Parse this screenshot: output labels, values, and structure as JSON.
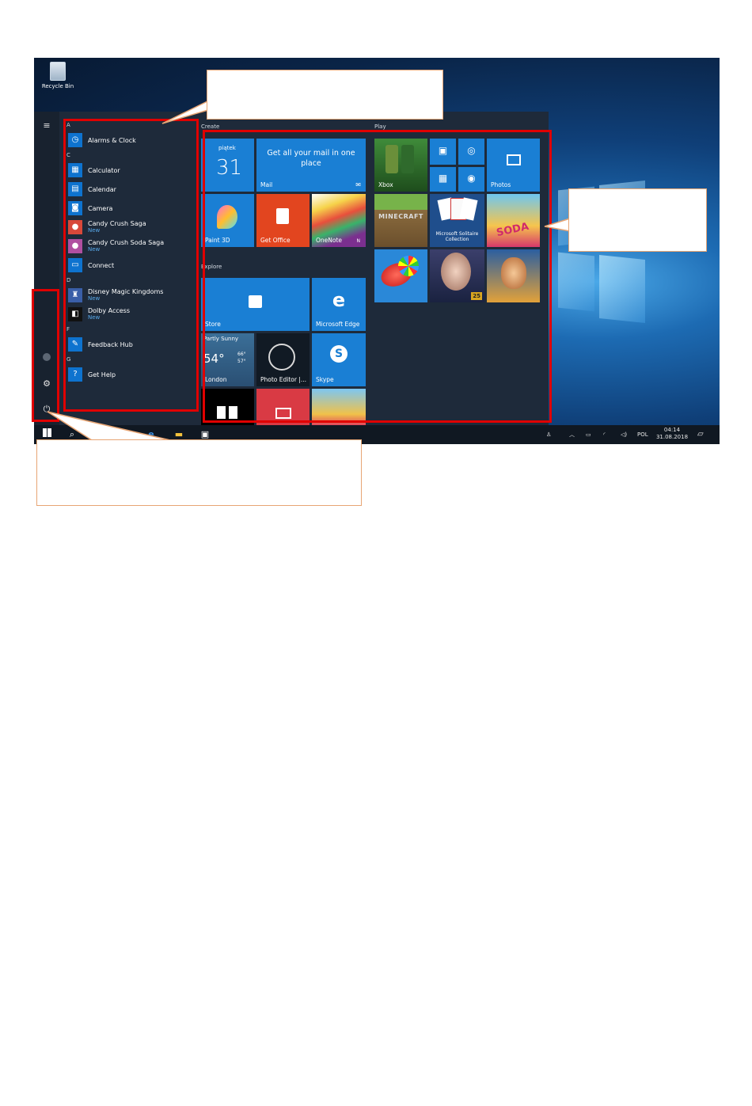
{
  "desktop": {
    "recycle_bin_label": "Recycle Bin"
  },
  "app_list": [
    {
      "type": "letter",
      "text": "A"
    },
    {
      "type": "app",
      "name": "Alarms & Clock",
      "icon": "alarm-clock-icon",
      "glyph": "◷"
    },
    {
      "type": "letter",
      "text": "C"
    },
    {
      "type": "app",
      "name": "Calculator",
      "icon": "calculator-icon",
      "glyph": "▦"
    },
    {
      "type": "app",
      "name": "Calendar",
      "icon": "calendar-icon",
      "glyph": "▤"
    },
    {
      "type": "app",
      "name": "Camera",
      "icon": "camera-icon",
      "glyph": "◙"
    },
    {
      "type": "app",
      "name": "Candy Crush Saga",
      "sub": "New",
      "icon": "candy-crush-icon",
      "glyph": "●",
      "color": "#d8483a"
    },
    {
      "type": "app",
      "name": "Candy Crush Soda Saga",
      "sub": "New",
      "icon": "candy-soda-icon",
      "glyph": "●",
      "color": "#b04fa0"
    },
    {
      "type": "app",
      "name": "Connect",
      "icon": "connect-icon",
      "glyph": "▭"
    },
    {
      "type": "letter",
      "text": "D"
    },
    {
      "type": "app",
      "name": "Disney Magic Kingdoms",
      "sub": "New",
      "icon": "disney-icon",
      "glyph": "♜",
      "color": "#3a5fa8"
    },
    {
      "type": "app",
      "name": "Dolby Access",
      "sub": "New",
      "icon": "dolby-icon",
      "glyph": "◧",
      "color": "#111111"
    },
    {
      "type": "letter",
      "text": "F"
    },
    {
      "type": "app",
      "name": "Feedback Hub",
      "icon": "feedback-hub-icon",
      "glyph": "✎"
    },
    {
      "type": "letter",
      "text": "G"
    },
    {
      "type": "app",
      "name": "Get Help",
      "icon": "get-help-icon",
      "glyph": "?"
    }
  ],
  "groups": {
    "create": "Create",
    "play": "Play",
    "explore": "Explore"
  },
  "tiles": {
    "calendar_day": "piątek",
    "calendar_date": "31",
    "mail_text": "Get all your mail in one place",
    "mail_label": "Mail",
    "paint3d": "Paint 3D",
    "office": "Get Office",
    "onenote": "OneNote",
    "xbox": "Xbox",
    "photos": "Photos",
    "solitaire": "Microsoft Solitaire Collection",
    "store": "Store",
    "edge": "Microsoft Edge",
    "weather_cond": "Partly Sunny",
    "weather_temp": "54°",
    "weather_hi": "66°",
    "weather_lo": "57°",
    "weather_city": "London",
    "photo_editor": "Photo Editor |...",
    "skype": "Skype",
    "minecraft": "MINECRAFT",
    "soda": "SODA",
    "badge_25": "25"
  },
  "taskbar": {
    "language": "POL",
    "time": "04:14",
    "date": "31.08.2018"
  }
}
